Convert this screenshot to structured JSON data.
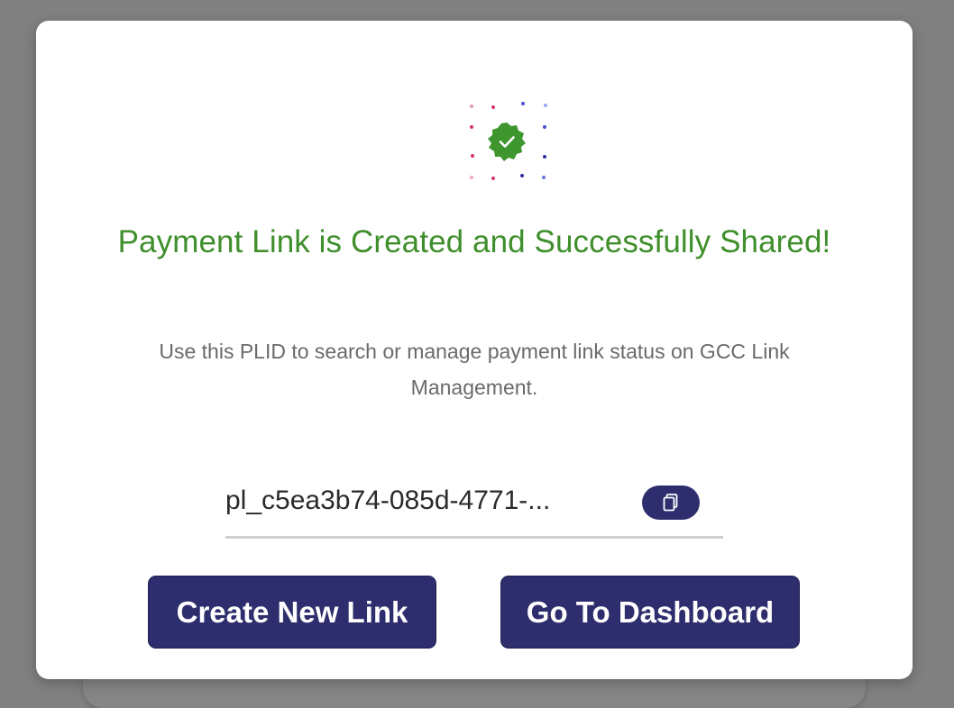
{
  "modal": {
    "title": "Payment Link is Created and Successfully Shared!",
    "subtitle": "Use this PLID to search or manage payment link status on GCC Link Management.",
    "plid_value": "pl_c5ea3b74-085d-4771-...",
    "copy_icon": "copy-icon",
    "success_icon": "check-badge-icon"
  },
  "actions": {
    "create_new_link": "Create New Link",
    "go_to_dashboard": "Go To Dashboard"
  },
  "colors": {
    "success_green": "#3f8f2c",
    "primary_navy": "#2e2e6e",
    "subtitle_gray": "#6a6a6a",
    "overlay_gray": "#808080"
  }
}
